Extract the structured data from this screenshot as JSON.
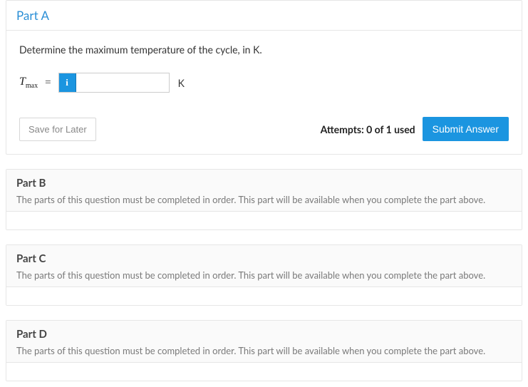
{
  "partA": {
    "title": "Part A",
    "question": "Determine the maximum temperature of the cycle, in K.",
    "variable_html": "T<sub>max</sub>",
    "equals": "=",
    "info_label": "i",
    "input_value": "",
    "unit": "K",
    "save_label": "Save for Later",
    "attempts": "Attempts: 0 of 1 used",
    "submit_label": "Submit Answer"
  },
  "locked_message": "The parts of this question must be completed in order. This part will be available when you complete the part above.",
  "partB": {
    "title": "Part B"
  },
  "partC": {
    "title": "Part C"
  },
  "partD": {
    "title": "Part D"
  }
}
